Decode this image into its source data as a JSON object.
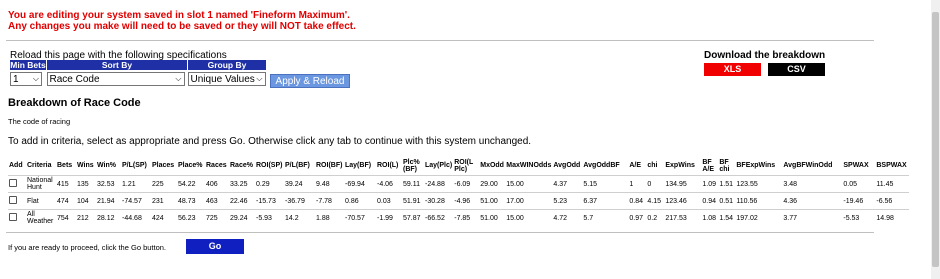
{
  "warning": {
    "line1": "You are editing your system saved in slot 1 named 'Fineform Maximum'.",
    "line2": "Any changes you make will need to be saved or they will NOT take effect."
  },
  "reload": {
    "title": "Reload this page with the following specifications",
    "min_bets_header": "Min Bets",
    "sort_by_header": "Sort By",
    "group_by_header": "Group By",
    "min_bets_value": "1",
    "sort_by_value": "Race Code",
    "group_by_value": "Unique Values",
    "apply_label": "Apply & Reload"
  },
  "download": {
    "title": "Download the breakdown",
    "xls": "XLS",
    "csv": "CSV"
  },
  "breakdown": {
    "title": "Breakdown of Race Code",
    "description": "The code of racing",
    "instructions": "To add in criteria, select as appropriate and press Go. Otherwise click any tab to continue with this system unchanged."
  },
  "table": {
    "headers": [
      "Add",
      "Criteria",
      "Bets",
      "Wins",
      "Win%",
      "P/L(SP)",
      "Places",
      "Place%",
      "Races",
      "Race%",
      "ROI(SP)",
      "P/L(BF)",
      "ROI(BF)",
      "Lay(BF)",
      "ROI(L)",
      "Plc% (BF)",
      "Lay(Plc)",
      "ROI(L Plc)",
      "MxOdd",
      "MaxWINOdds",
      "AvgOdd",
      "AvgOddBF",
      "A/E",
      "chi",
      "ExpWins",
      "BF A/E",
      "BF chi",
      "BFExpWins",
      "AvgBFWinOdd",
      "SPWAX",
      "BSPWAX"
    ],
    "rows": [
      [
        "",
        "National Hunt",
        "415",
        "135",
        "32.53",
        "1.21",
        "225",
        "54.22",
        "406",
        "33.25",
        "0.29",
        "39.24",
        "9.48",
        "-69.94",
        "-4.06",
        "59.11",
        "-24.88",
        "-6.09",
        "29.00",
        "15.00",
        "4.37",
        "5.15",
        "1",
        "0",
        "134.95",
        "1.09",
        "1.51",
        "123.55",
        "3.48",
        "0.05",
        "11.45"
      ],
      [
        "",
        "Flat",
        "474",
        "104",
        "21.94",
        "-74.57",
        "231",
        "48.73",
        "463",
        "22.46",
        "-15.73",
        "-36.79",
        "-7.78",
        "0.86",
        "0.03",
        "51.91",
        "-30.28",
        "-4.96",
        "51.00",
        "17.00",
        "5.23",
        "6.37",
        "0.84",
        "4.15",
        "123.46",
        "0.94",
        "0.51",
        "110.56",
        "4.36",
        "-19.46",
        "-6.56"
      ],
      [
        "",
        "All Weather",
        "754",
        "212",
        "28.12",
        "-44.68",
        "424",
        "56.23",
        "725",
        "29.24",
        "-5.93",
        "14.2",
        "1.88",
        "-70.57",
        "-1.99",
        "57.87",
        "-66.52",
        "-7.85",
        "51.00",
        "15.00",
        "4.72",
        "5.7",
        "0.97",
        "0.2",
        "217.53",
        "1.08",
        "1.54",
        "197.02",
        "3.77",
        "-5.53",
        "14.98"
      ]
    ]
  },
  "footer": {
    "proceed_text": "If you are ready to proceed, click the Go button.",
    "go_label": "Go"
  }
}
